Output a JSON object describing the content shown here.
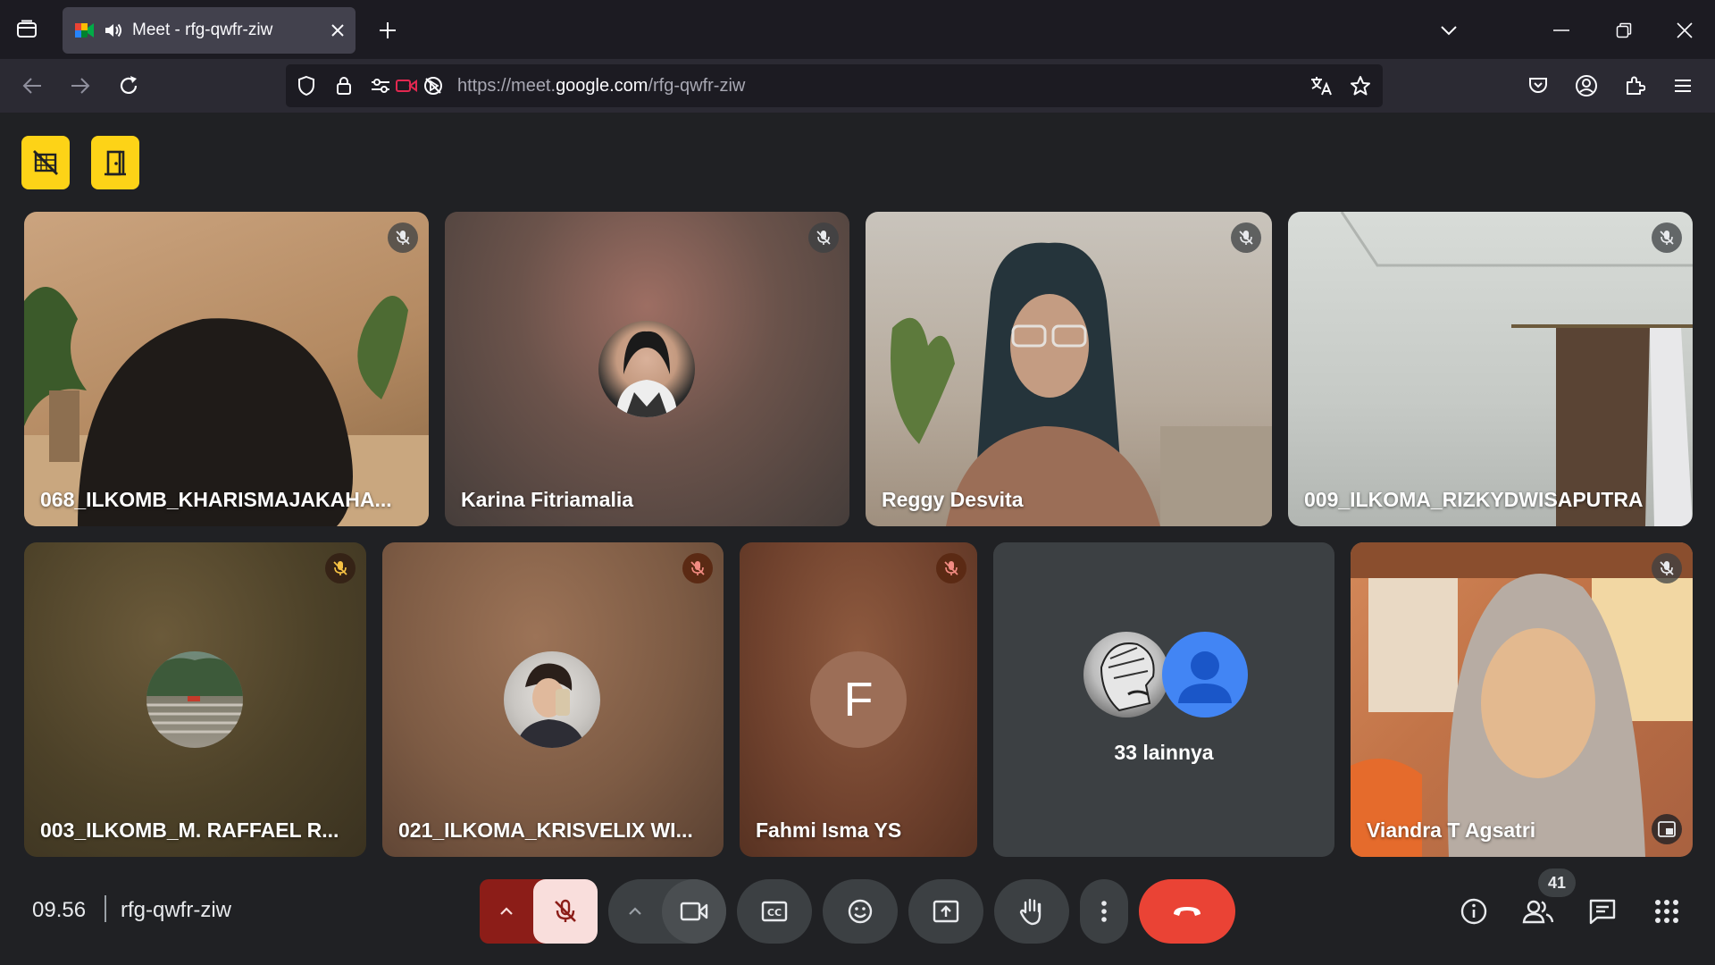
{
  "browser": {
    "tab_title": "Meet - rfg-qwfr-ziw",
    "url_prefix": "https://meet.",
    "url_host": "google.com",
    "url_path": "/rfg-qwfr-ziw"
  },
  "meet": {
    "toolbar_icons": [
      "video-off-icon",
      "door-icon"
    ],
    "participants": [
      {
        "name": "068_ILKOMB_KHARISMAJAKAHA...",
        "muted": true
      },
      {
        "name": "Karina Fitriamalia",
        "muted": true
      },
      {
        "name": "Reggy Desvita",
        "muted": true
      },
      {
        "name": "009_ILKOMA_RIZKYDWISAPUTRA",
        "muted": true
      },
      {
        "name": "003_ILKOMB_M. RAFFAEL R...",
        "muted": true
      },
      {
        "name": "021_ILKOMA_KRISVELIX WI...",
        "muted": true
      },
      {
        "name": "Fahmi Isma YS",
        "muted": true,
        "initial": "F"
      },
      {
        "name": "Viandra T Agsatri",
        "muted": true
      }
    ],
    "others_label": "33 lainnya",
    "clock": "09.56",
    "meeting_code": "rfg-qwfr-ziw",
    "people_count": "41"
  },
  "colors": {
    "accent_yellow": "#fdd317",
    "end_call_red": "#ea4335",
    "mic_off_bg": "#f9dedc",
    "mic_group_dark": "#8c1d18"
  }
}
